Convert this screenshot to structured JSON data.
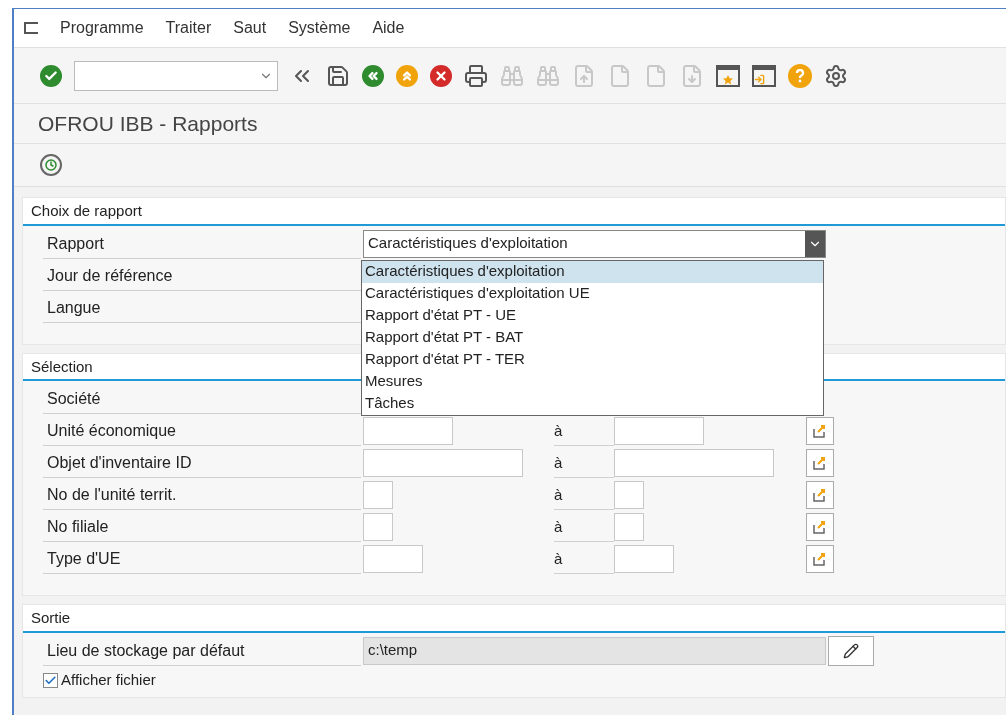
{
  "menu": [
    {
      "label": "Programme"
    },
    {
      "label": "Traiter"
    },
    {
      "label": "Saut"
    },
    {
      "label": "Système"
    },
    {
      "label": "Aide"
    }
  ],
  "toolbar": [
    {
      "kind": "enter",
      "disabled": false
    },
    {
      "kind": "command",
      "disabled": false
    },
    {
      "kind": "collapse",
      "disabled": false
    },
    {
      "kind": "save",
      "disabled": false
    },
    {
      "kind": "back",
      "disabled": false
    },
    {
      "kind": "exit",
      "disabled": false
    },
    {
      "kind": "cancel",
      "disabled": false
    },
    {
      "kind": "print",
      "disabled": false
    },
    {
      "kind": "find",
      "disabled": true
    },
    {
      "kind": "find-next",
      "disabled": true
    },
    {
      "kind": "first",
      "disabled": true
    },
    {
      "kind": "prev",
      "disabled": true
    },
    {
      "kind": "next",
      "disabled": true
    },
    {
      "kind": "last",
      "disabled": true
    },
    {
      "kind": "new-window",
      "disabled": false
    },
    {
      "kind": "shortcut",
      "disabled": false
    },
    {
      "kind": "help",
      "disabled": false
    },
    {
      "kind": "settings",
      "disabled": false
    }
  ],
  "title": "OFROU IBB - Rapports",
  "report_section": {
    "heading": "Choix de rapport",
    "rows": [
      {
        "label": "Rapport"
      },
      {
        "label": "Jour de référence"
      },
      {
        "label": "Langue"
      }
    ],
    "dropdown": {
      "value": "Caractéristiques d'exploitation",
      "options": [
        {
          "label": "Caractéristiques d'exploitation",
          "selected": true
        },
        {
          "label": "Caractéristiques d'exploitation UE",
          "selected": false
        },
        {
          "label": "Rapport d'état PT - UE",
          "selected": false
        },
        {
          "label": "Rapport d'état PT - BAT",
          "selected": false
        },
        {
          "label": "Rapport d'état PT - TER",
          "selected": false
        },
        {
          "label": "Mesures",
          "selected": false
        },
        {
          "label": "Tâches",
          "selected": false
        }
      ]
    }
  },
  "selection_section": {
    "heading": "Sélection",
    "rows": [
      {
        "label": "Société",
        "kind": "covered"
      },
      {
        "label": "Unité économique",
        "kind": "medium",
        "to": "à"
      },
      {
        "label": "Objet d'inventaire ID",
        "kind": "long",
        "to": "à"
      },
      {
        "label": "No de l'unité territ.",
        "kind": "tiny",
        "to": "à"
      },
      {
        "label": "No filiale",
        "kind": "tiny",
        "to": "à"
      },
      {
        "label": "Type d'UE",
        "kind": "short",
        "to": "à"
      }
    ]
  },
  "output_section": {
    "heading": "Sortie",
    "path_label": "Lieu de stockage par défaut",
    "path_value": "c:\\temp",
    "checkbox": {
      "label": "Afficher fichier",
      "checked": true
    }
  }
}
